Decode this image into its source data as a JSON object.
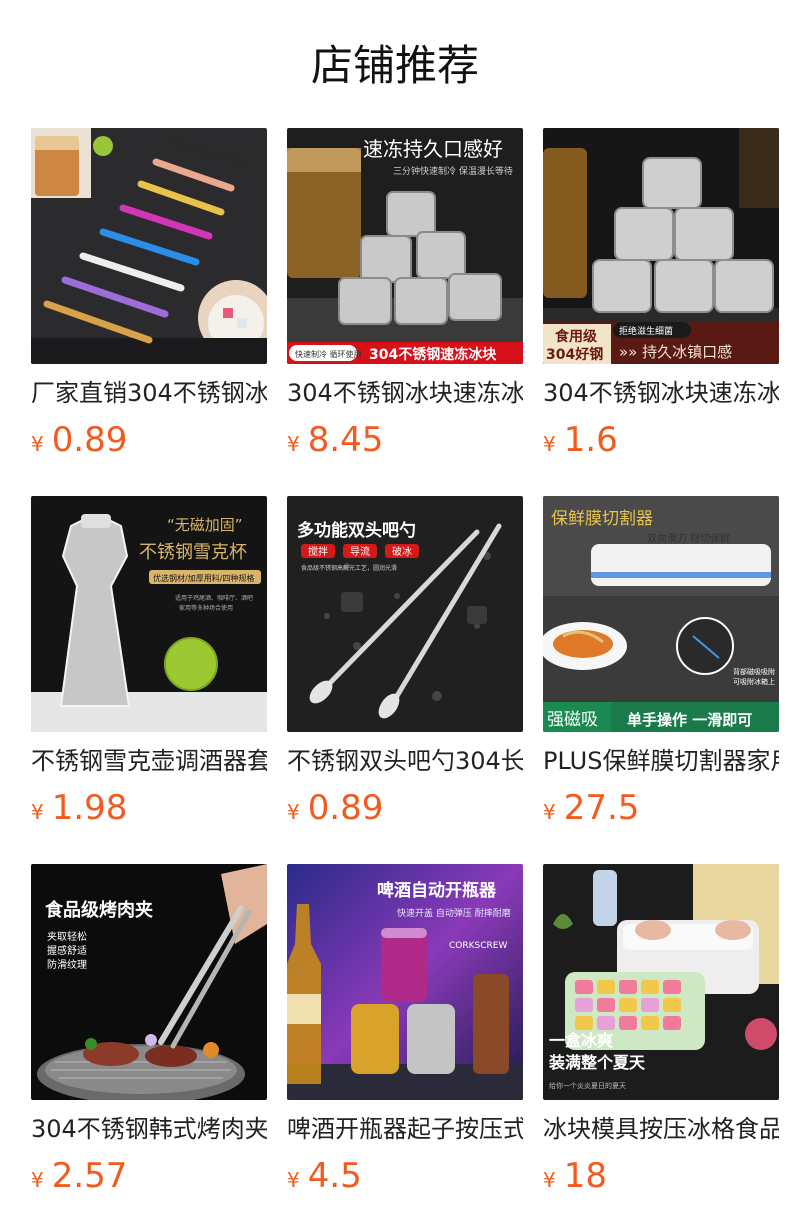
{
  "page": {
    "title": "店铺推荐"
  },
  "products": [
    {
      "name": "厂家直销304不锈钢冰",
      "currency": "¥",
      "price": "0.89",
      "image_text": []
    },
    {
      "name": "304不锈钢冰块速冻冰",
      "currency": "¥",
      "price": "8.45",
      "image_text": [
        "速冻持久口感好",
        "三分钟快速制冷 保温漫长等待",
        "快速制冷 循环使用",
        "304不锈钢速冻冰块"
      ]
    },
    {
      "name": "304不锈钢冰块速冻冰",
      "currency": "¥",
      "price": "1.6",
      "image_text": [
        "食用级",
        "304好钢",
        "拒绝滋生细菌",
        "»»  持久冰镇口感"
      ]
    },
    {
      "name": "不锈钢雪克壶调酒器套",
      "currency": "¥",
      "price": "1.98",
      "image_text": [
        "“无磁加固”",
        "不锈钢雪克杯",
        "优选钢材/加厚用料/四种规格",
        "适用于鸡尾酒、咖啡厅、酒吧",
        "家用等多种场合使用"
      ]
    },
    {
      "name": "不锈钢双头吧勺304长",
      "currency": "¥",
      "price": "0.89",
      "image_text": [
        "多功能双头吧勺",
        "搅拌",
        "导流",
        "破冰",
        "食品级不锈钢高解光工艺，圆润光滑"
      ]
    },
    {
      "name": "PLUS保鲜膜切割器家用",
      "currency": "¥",
      "price": "27.5",
      "image_text": [
        "保鲜膜切割器",
        "双向滑刀 轻切保鲜",
        "背部磁吸吸附",
        "可吸附冰箱上",
        "强磁吸",
        "单手操作 一滑即可"
      ]
    },
    {
      "name": "304不锈钢韩式烤肉夹",
      "currency": "¥",
      "price": "2.57",
      "image_text": [
        "食品级烤肉夹",
        "夹取轻松",
        "握感舒适",
        "防滑纹理"
      ]
    },
    {
      "name": "啤酒开瓶器起子按压式",
      "currency": "¥",
      "price": "4.5",
      "image_text": [
        "啤酒自动开瓶器",
        "快速开盖 自动弹压 耐摔耐磨",
        "CORKSCREW"
      ]
    },
    {
      "name": "冰块模具按压冰格食品",
      "currency": "¥",
      "price": "18",
      "image_text": [
        "一盒冰爽",
        "装满整个夏天",
        "给你一个炎炎夏日的夏天"
      ]
    }
  ]
}
